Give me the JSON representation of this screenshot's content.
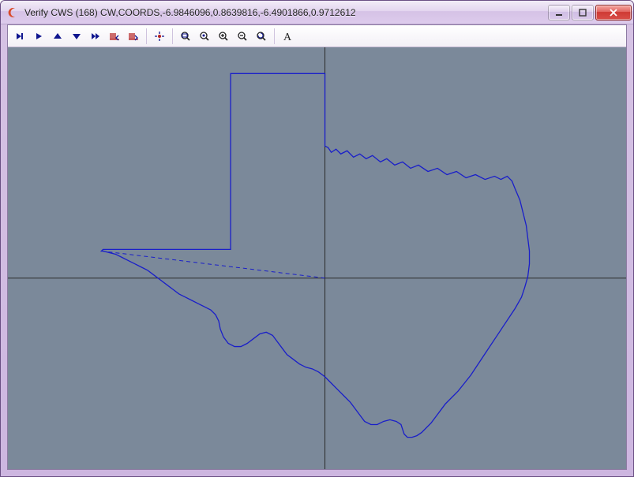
{
  "window": {
    "title": "Verify CWS (168) CW,COORDS,-6.9846096,0.8639816,-6.4901866,0.9712612",
    "app_icon": "crescent-icon"
  },
  "toolbar": {
    "items": [
      {
        "name": "step-end-icon"
      },
      {
        "name": "play-icon"
      },
      {
        "name": "triangle-up-icon"
      },
      {
        "name": "triangle-down-icon"
      },
      {
        "name": "fast-forward-icon"
      },
      {
        "name": "comb-left-icon"
      },
      {
        "name": "comb-right-icon"
      },
      {
        "sep": true
      },
      {
        "name": "center-target-icon"
      },
      {
        "sep": true
      },
      {
        "name": "zoom-fit-icon"
      },
      {
        "name": "zoom-all-icon"
      },
      {
        "name": "zoom-in-icon"
      },
      {
        "name": "zoom-out-icon"
      },
      {
        "name": "zoom-reset-icon"
      },
      {
        "sep": true
      },
      {
        "name": "text-tool-icon"
      }
    ]
  },
  "status": {
    "cws_index": 168,
    "direction": "CW",
    "mode": "COORDS",
    "coords": [
      -6.9846096,
      0.8639816,
      -6.4901866,
      0.9712612
    ]
  }
}
